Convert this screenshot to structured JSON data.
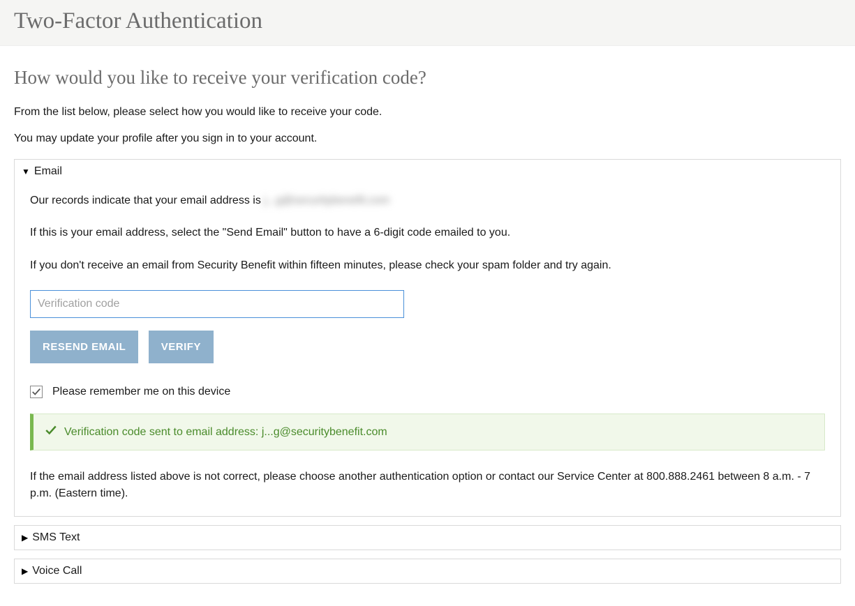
{
  "header": {
    "title": "Two-Factor Authentication"
  },
  "subheading": "How would you like to receive your verification code?",
  "intro1": "From the list below, please select how you would like to receive your code.",
  "intro2": "You may update your profile after you sign in to your account.",
  "email_panel": {
    "label": "Email",
    "records_prefix": "Our records indicate that your email address is",
    "records_email_blurred": "j...g@securitybenefit.com",
    "instruction": "If this is your email address, select the \"Send Email\" button to have a 6-digit code emailed to you.",
    "spam_note": "If you don't receive an email from Security Benefit within fifteen minutes, please check your spam folder and try again.",
    "code_placeholder": "Verification code",
    "code_value": "",
    "resend_label": "RESEND EMAIL",
    "verify_label": "VERIFY",
    "remember_label": "Please remember me on this device",
    "remember_checked": true,
    "alert_text": "Verification code sent to email address: j...g@securitybenefit.com",
    "footer_note": "If the email address listed above is not correct, please choose another authentication option or contact our Service Center at 800.888.2461 between 8 a.m. - 7 p.m. (Eastern time)."
  },
  "sms_panel": {
    "label": "SMS Text"
  },
  "voice_panel": {
    "label": "Voice Call"
  }
}
